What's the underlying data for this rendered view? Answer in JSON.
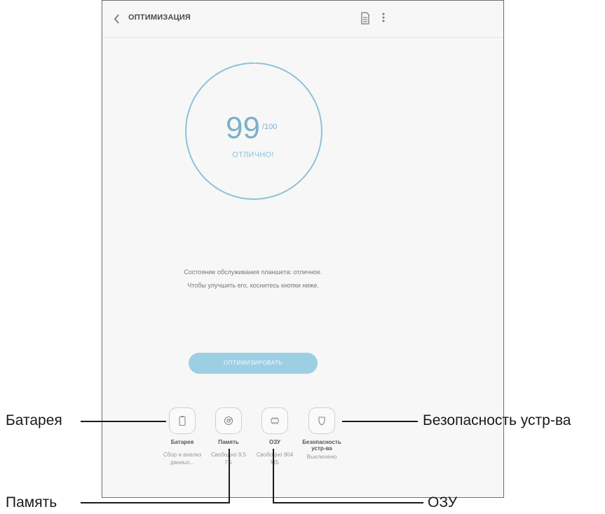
{
  "header": {
    "title": "ОПТИМИЗАЦИЯ",
    "back_icon": "chevron-left-icon",
    "doc_icon": "document-icon",
    "more_icon": "more-vertical-icon"
  },
  "gauge": {
    "score": "99",
    "max": "/100",
    "status": "ОТЛИЧНО!",
    "accent": "#7bb1c9"
  },
  "description": {
    "line1": "Состояние обслуживания планшета: отличное.",
    "line2": "Чтобы улучшить его, коснитесь кнопки ниже."
  },
  "optimize_button": {
    "label": "ОПТИМИЗИРОВАТЬ",
    "color": "#9dcfe4"
  },
  "cards": [
    {
      "icon": "battery-icon",
      "label": "Батарея",
      "value1": "Сбор и анализ",
      "value2": "данных..."
    },
    {
      "icon": "storage-icon",
      "label": "Память",
      "value1": "Свободно 9,5",
      "value2": "ГБ"
    },
    {
      "icon": "ram-icon",
      "label": "ОЗУ",
      "value1": "Свободно 904",
      "value2": "МБ"
    },
    {
      "icon": "shield-icon",
      "label1": "Безопасность",
      "label2": "устр-ва",
      "value1": "Выключено",
      "value2": ""
    }
  ],
  "callouts": {
    "battery": "Батарея",
    "memory": "Память",
    "ram": "ОЗУ",
    "security": "Безопасность устр-ва"
  }
}
